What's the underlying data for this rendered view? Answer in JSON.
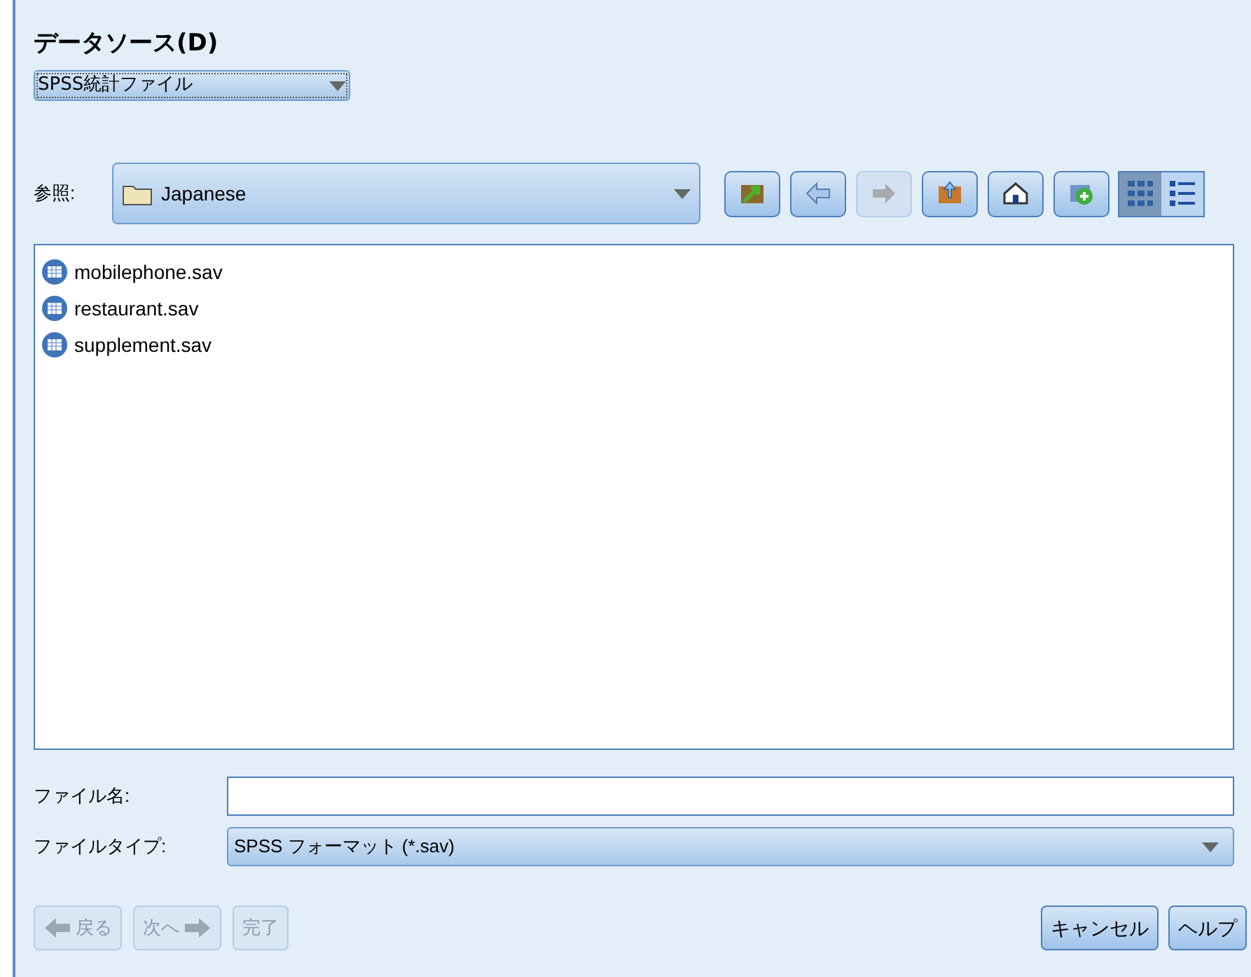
{
  "title": "データソース(D)",
  "source_dropdown": {
    "value": "SPSS統計ファイル"
  },
  "look_in": {
    "label": "参照:",
    "value": "Japanese"
  },
  "toolbar": [
    {
      "kind": "jump",
      "disabled": false
    },
    {
      "kind": "back",
      "disabled": false
    },
    {
      "kind": "forward",
      "disabled": true
    },
    {
      "kind": "up",
      "disabled": false
    },
    {
      "kind": "home",
      "disabled": false
    },
    {
      "kind": "new-folder",
      "disabled": false
    }
  ],
  "view_toggles": [
    {
      "kind": "icons",
      "selected": true
    },
    {
      "kind": "details",
      "selected": false
    }
  ],
  "files": [
    "mobilephone.sav",
    "restaurant.sav",
    "supplement.sav"
  ],
  "file_name": {
    "label": "ファイル名:"
  },
  "file_type": {
    "label": "ファイルタイプ:",
    "value": "SPSS フォーマット (*.sav)"
  },
  "nav_buttons": [
    {
      "kind": "back",
      "label": "戻る",
      "disabled": true
    },
    {
      "kind": "next",
      "label": "次へ",
      "disabled": true
    },
    {
      "kind": "finish",
      "label": "完了",
      "disabled": true
    }
  ],
  "action_buttons": [
    "キャンセル",
    "ヘルプ"
  ]
}
